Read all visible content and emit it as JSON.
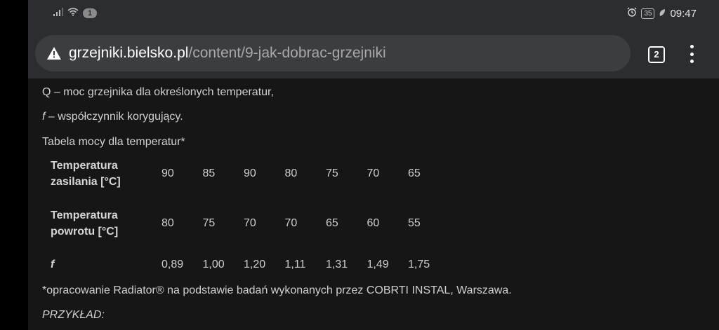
{
  "statusbar": {
    "notification_count": "1",
    "battery": "35",
    "time": "09:47"
  },
  "toolbar": {
    "url_domain": "grzejniki.bielsko.pl",
    "url_path": "/content/9-jak-dobrac-grzejniki",
    "tab_count": "2"
  },
  "content": {
    "line_q": "Q – moc grzejnika dla określonych temperatur,",
    "line_f_symbol": "f",
    "line_f_rest": " – współczynnik korygujący.",
    "table_caption": "Tabela mocy dla temperatur*",
    "table": {
      "rows": [
        {
          "header_line1": "Temperatura",
          "header_line2": "zasilania [°C]",
          "values": [
            "90",
            "85",
            "90",
            "80",
            "75",
            "70",
            "65"
          ]
        },
        {
          "header_line1": "Temperatura",
          "header_line2": "powrotu [°C]",
          "values": [
            "80",
            "75",
            "70",
            "70",
            "65",
            "60",
            "55"
          ]
        },
        {
          "header_line1": "f",
          "header_line2": "",
          "values": [
            "0,89",
            "1,00",
            "1,20",
            "1,11",
            "1,31",
            "1,49",
            "1,75"
          ]
        }
      ]
    },
    "footnote": "*opracowanie Radiator® na podstawie badań wykonanych przez COBRTI INSTAL, Warszawa.",
    "example_label": "PRZYKŁAD:"
  }
}
